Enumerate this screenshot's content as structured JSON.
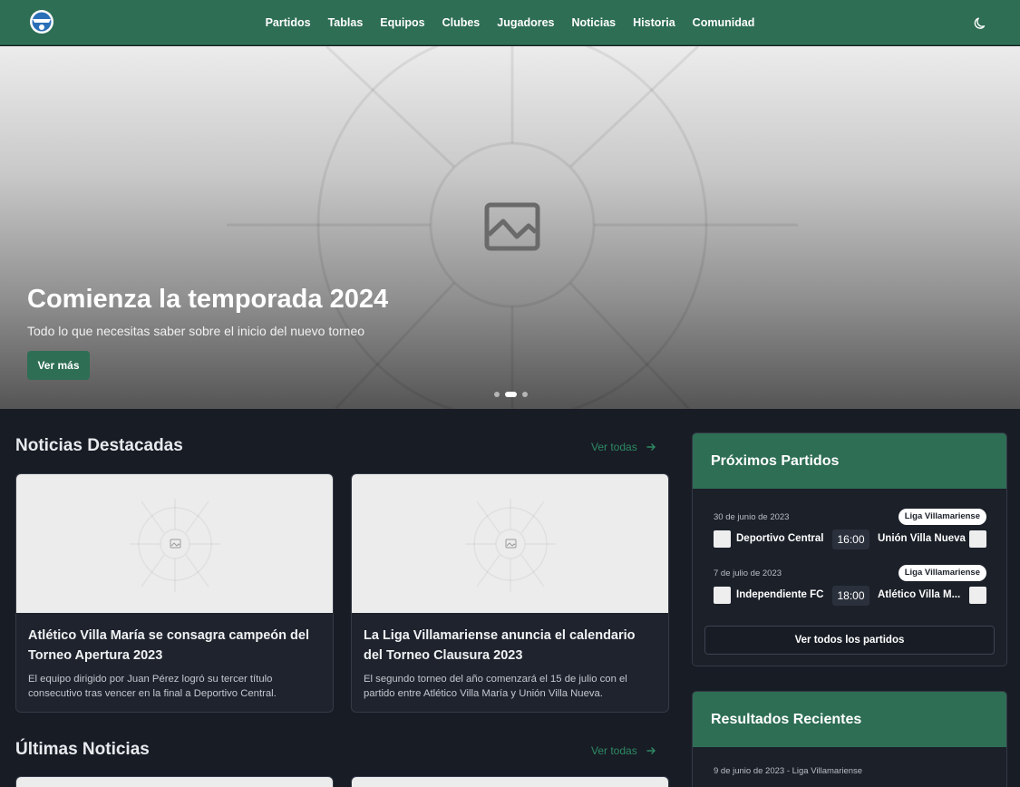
{
  "nav": {
    "items": [
      {
        "label": "Partidos"
      },
      {
        "label": "Tablas"
      },
      {
        "label": "Equipos"
      },
      {
        "label": "Clubes"
      },
      {
        "label": "Jugadores"
      },
      {
        "label": "Noticias"
      },
      {
        "label": "Historia"
      },
      {
        "label": "Comunidad"
      }
    ],
    "logo_icon": "league-logo-icon",
    "theme_icon": "moon-icon"
  },
  "hero": {
    "title": "Comienza la temporada 2024",
    "subtitle": "Todo lo que necesitas saber sobre el inicio del nuevo torneo",
    "button_label": "Ver más",
    "slides_total": 3,
    "active_slide": 2,
    "image_icon": "image-placeholder-icon"
  },
  "featured": {
    "title": "Noticias Destacadas",
    "see_all_label": "Ver todas",
    "cards": [
      {
        "title": "Atlético Villa María se consagra campeón del Torneo Apertura 2023",
        "text": "El equipo dirigido por Juan Pérez logró su tercer título consecutivo tras vencer en la final a Deportivo Central."
      },
      {
        "title": "La Liga Villamariense anuncia el calendario del Torneo Clausura 2023",
        "text": "El segundo torneo del año comenzará el 15 de julio con el partido entre Atlético Villa María y Unión Villa Nueva."
      }
    ]
  },
  "latest": {
    "title": "Últimas Noticias",
    "see_all_label": "Ver todas"
  },
  "upcoming": {
    "title": "Próximos Partidos",
    "matches": [
      {
        "date": "30 de junio de 2023",
        "league": "Liga Villamariense",
        "home": "Deportivo Central",
        "time": "16:00",
        "away": "Unión Villa Nueva"
      },
      {
        "date": "7 de julio de 2023",
        "league": "Liga Villamariense",
        "home": "Independiente FC",
        "time": "18:00",
        "away": "Atlético Villa M..."
      }
    ],
    "button_label": "Ver todos los partidos"
  },
  "recent": {
    "title": "Resultados Recientes",
    "first_line": "9 de junio de 2023 - Liga Villamariense"
  },
  "colors": {
    "brand": "#2e6e55",
    "background": "#181c25",
    "card": "#1e232d"
  }
}
